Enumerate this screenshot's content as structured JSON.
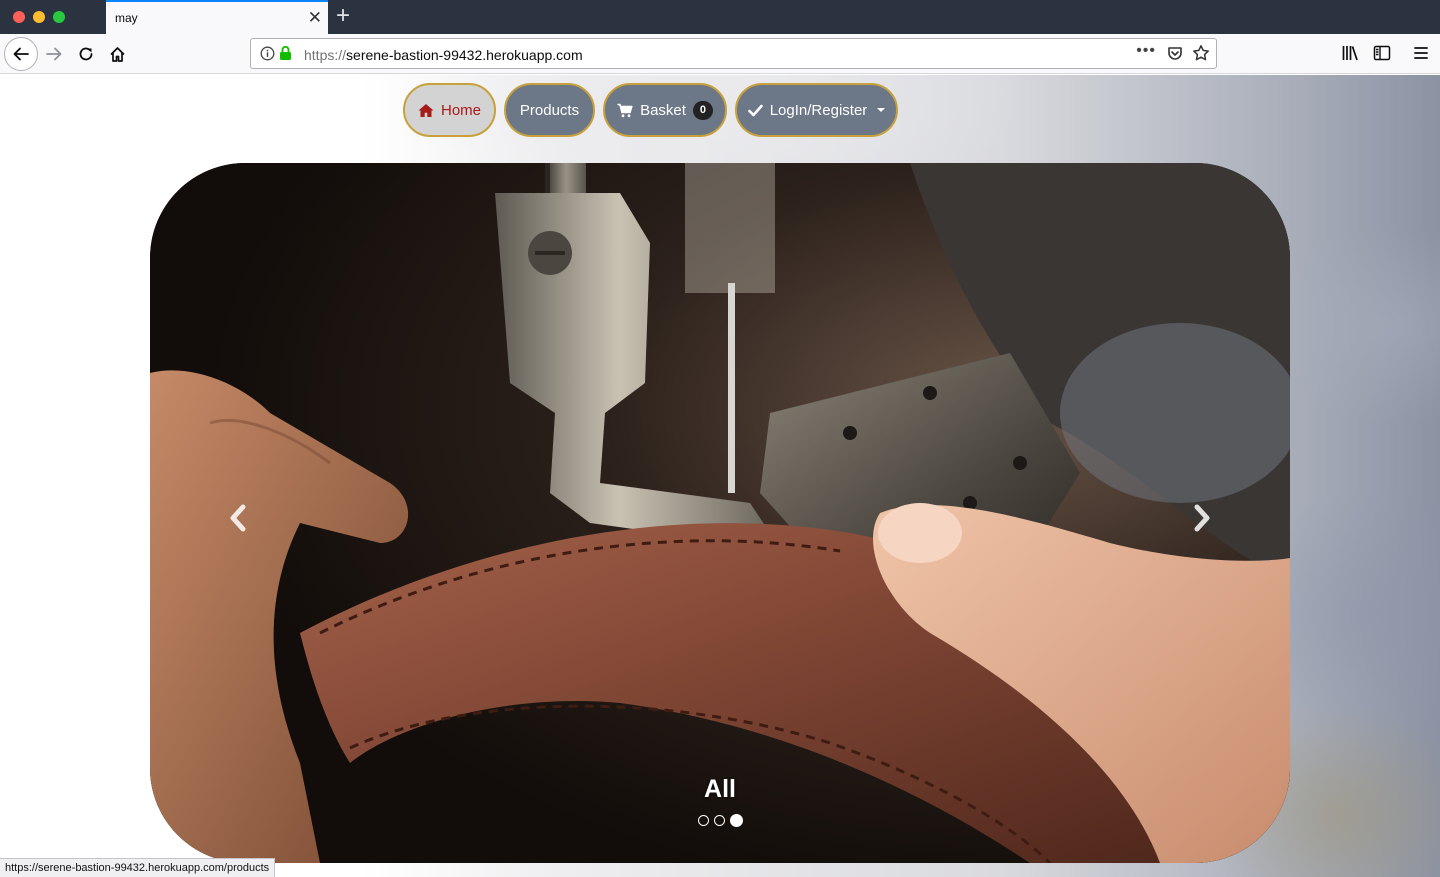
{
  "browser": {
    "tab_title": "may",
    "url_scheme": "https://",
    "url_host": "serene-bastion-99432.herokuapp.com",
    "url_more": "•••",
    "status_url": "https://serene-bastion-99432.herokuapp.com/products"
  },
  "nav": {
    "home": "Home",
    "products": "Products",
    "basket": "Basket",
    "basket_count": "0",
    "login": "LogIn/Register"
  },
  "carousel": {
    "caption": "All",
    "slide_count": 3,
    "active_index": 2
  },
  "colors": {
    "pill_bg": "#6c7887",
    "pill_border": "#c8a13c",
    "home_text": "#a61a1a",
    "tab_accent": "#0a84ff"
  }
}
